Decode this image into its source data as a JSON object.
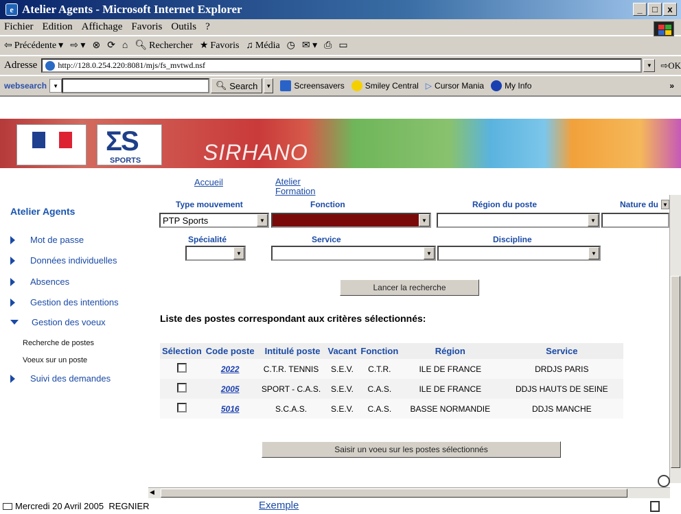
{
  "window": {
    "title": "Atelier Agents - Microsoft Internet Explorer",
    "buttons": [
      "_",
      "□",
      "x"
    ]
  },
  "menu": [
    "Fichier",
    "Edition",
    "Affichage",
    "Favoris",
    "Outils",
    "?"
  ],
  "toolbar": {
    "back": "Précédente",
    "search": "Rechercher",
    "favorites": "Favoris",
    "media": "Média"
  },
  "address": {
    "label": "Adresse",
    "url": "http://128.0.254.220:8081/mjs/fs_mvtwd.nsf",
    "go": "OK"
  },
  "searchbar": {
    "brand": "websearch",
    "search_label": "Search",
    "items": [
      "Screensavers",
      "Smiley Central",
      "Cursor Mania",
      "My Info"
    ]
  },
  "banner": {
    "logo_brand": "SPORTS",
    "title": "SIRHANO"
  },
  "topnav": {
    "home": "Accueil",
    "training": "Atelier Formation"
  },
  "sidebar": {
    "title": "Atelier Agents",
    "items": [
      {
        "label": "Mot de passe"
      },
      {
        "label": "Données individuelles"
      },
      {
        "label": "Absences"
      },
      {
        "label": "Gestion des intentions"
      },
      {
        "label": "Gestion des voeux"
      }
    ],
    "subitems": [
      "Recherche de postes",
      "Voeux sur un poste"
    ],
    "last": "Suivi des demandes"
  },
  "filters": {
    "type_mouvement": {
      "label": "Type mouvement",
      "value": "PTP Sports"
    },
    "fonction": {
      "label": "Fonction",
      "value": ""
    },
    "region": {
      "label": "Région du poste",
      "value": ""
    },
    "nature": {
      "label": "Nature du p",
      "value": ""
    },
    "specialite": {
      "label": "Spécialité",
      "value": ""
    },
    "service": {
      "label": "Service",
      "value": ""
    },
    "discipline": {
      "label": "Discipline",
      "value": ""
    }
  },
  "search_button": "Lancer la recherche",
  "results": {
    "title": "Liste des postes correspondant aux critères sélectionnés:",
    "headers": [
      "Sélection",
      "Code poste",
      "Intitulé poste",
      "Vacant",
      "Fonction",
      "Région",
      "Service"
    ],
    "rows": [
      {
        "code": "2022",
        "title": "C.T.R. TENNIS",
        "vacant": "S.E.V.",
        "function": "C.T.R.",
        "region": "ILE DE FRANCE",
        "service": "DRDJS PARIS"
      },
      {
        "code": "2005",
        "title": "SPORT - C.A.S.",
        "vacant": "S.E.V.",
        "function": "C.A.S.",
        "region": "ILE DE FRANCE",
        "service": "DDJS HAUTS DE SEINE"
      },
      {
        "code": "5016",
        "title": "S.C.A.S.",
        "vacant": "S.E.V.",
        "function": "C.A.S.",
        "region": "BASSE NORMANDIE",
        "service": "DDJS MANCHE"
      }
    ]
  },
  "submit_button": "Saisir un voeu sur les postes sélectionnés",
  "status": {
    "date": "Mercredi 20 Avril 2005",
    "user": "REGNIER",
    "link": "Exemple"
  },
  "colors": {
    "link": "#1a4aa5",
    "fonction_selected": "#7a0a0a"
  }
}
